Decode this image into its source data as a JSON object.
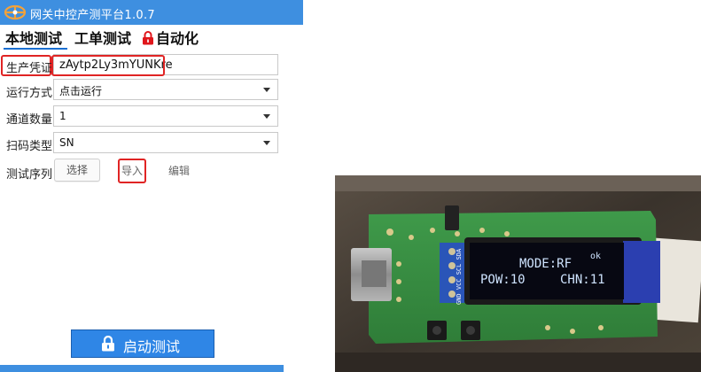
{
  "app": {
    "title": "网关中控产测平台1.0.7",
    "tabs": [
      {
        "label": "本地测试",
        "active": true
      },
      {
        "label": "工单测试",
        "active": false
      },
      {
        "label": "自动化",
        "locked": true
      }
    ],
    "form": {
      "credential": {
        "label": "生产凭证",
        "value": "zAytp2Ly3mYUNKre"
      },
      "run_mode": {
        "label": "运行方式",
        "value": "点击运行"
      },
      "channel_count": {
        "label": "通道数量",
        "value": "1"
      },
      "scan_type": {
        "label": "扫码类型",
        "value": "SN"
      },
      "sequence": {
        "label": "测试序列",
        "select_label": "选择",
        "import_label": "导入",
        "edit_label": "编辑"
      }
    },
    "start_button": {
      "label": "启动测试"
    }
  },
  "photo": {
    "oled_lines": [
      "MODE:RF",
      "POW:10",
      "CHN:11"
    ],
    "oled_indicator": "ok",
    "header_pins": "GND VCC SCL SDA"
  },
  "colors": {
    "titlebar": "#3e8fe0",
    "highlight_red": "#e02424",
    "primary_button": "#2f86e6",
    "tab_lock": "#e0161b"
  }
}
